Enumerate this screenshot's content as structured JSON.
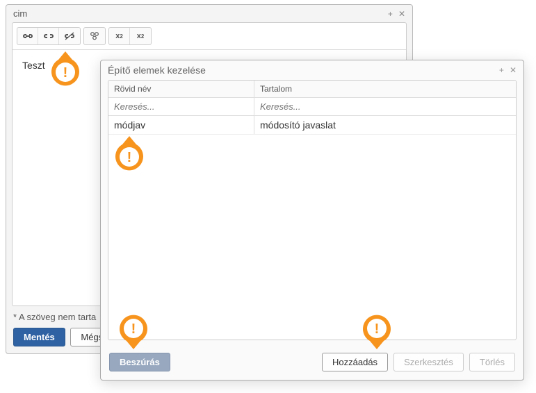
{
  "editor": {
    "title": "cim",
    "body_text": "Teszt",
    "footer_note": "* A szöveg nem tarta",
    "save_label": "Mentés",
    "cancel_label": "Mégs"
  },
  "dialog": {
    "title": "Építő elemek kezelése",
    "columns": {
      "short_name": "Rövid név",
      "content": "Tartalom"
    },
    "filter_placeholder": "Keresés...",
    "rows": [
      {
        "short": "módjav",
        "content": "módosító javaslat"
      }
    ],
    "buttons": {
      "insert": "Beszúrás",
      "add": "Hozzáadás",
      "edit": "Szerkesztés",
      "delete": "Törlés"
    }
  }
}
